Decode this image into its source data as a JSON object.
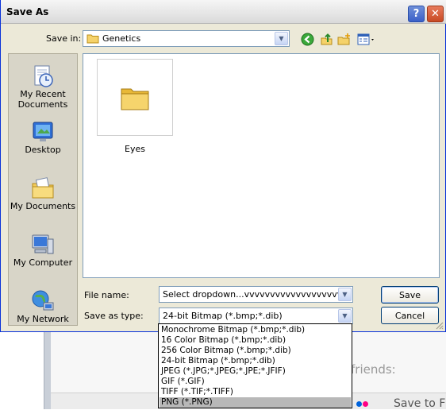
{
  "dialog": {
    "title": "Save As",
    "help_label": "?",
    "close_label": "✕"
  },
  "save_in": {
    "label": "Save in:",
    "value": "Genetics"
  },
  "places": [
    {
      "label": "My Recent Documents",
      "icon": "recent-documents-icon"
    },
    {
      "label": "Desktop",
      "icon": "desktop-icon"
    },
    {
      "label": "My Documents",
      "icon": "my-documents-icon"
    },
    {
      "label": "My Computer",
      "icon": "my-computer-icon"
    },
    {
      "label": "My Network",
      "icon": "my-network-icon"
    }
  ],
  "files": [
    {
      "name": "Eyes",
      "type": "folder"
    }
  ],
  "file_name": {
    "label": "File name:",
    "value": "Select dropdown...vvvvvvvvvvvvvvvvvvvv"
  },
  "save_as_type": {
    "label": "Save as type:",
    "value": "24-bit Bitmap (*.bmp;*.dib)",
    "options": [
      "Monochrome Bitmap (*.bmp;*.dib)",
      "16 Color Bitmap (*.bmp;*.dib)",
      "256 Color Bitmap (*.bmp;*.dib)",
      "24-bit Bitmap (*.bmp;*.dib)",
      "JPEG (*.JPG;*.JPEG;*.JPE;*.JFIF)",
      "GIF (*.GIF)",
      "TIFF (*.TIF;*.TIFF)",
      "PNG (*.PNG)"
    ],
    "highlighted_index": 7
  },
  "buttons": {
    "save": "Save",
    "cancel": "Cancel"
  },
  "background": {
    "friends_text": "friends:",
    "save_to_text": "Save to F"
  },
  "colors": {
    "dialog_bg": "#ece9d8",
    "highlight": "#b8b8b8",
    "accent_border": "#7f9db9"
  }
}
